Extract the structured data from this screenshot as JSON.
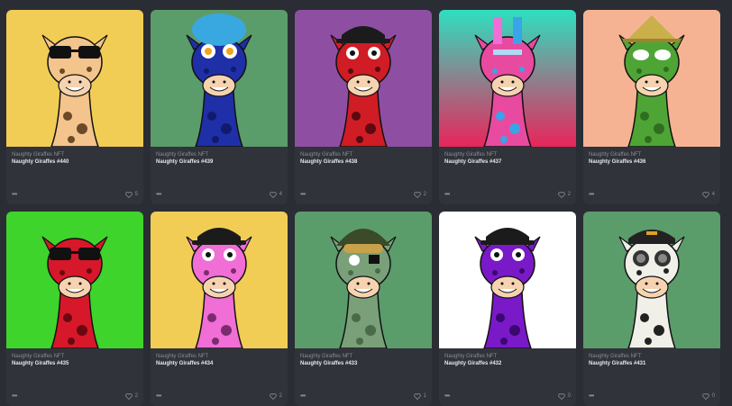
{
  "cards": [
    {
      "collection": "Naughty Giraffes NFT",
      "name": "Naughty Giraffes #440",
      "likes": "5",
      "bg": "#f2cd55",
      "body": "#f3c48b",
      "spots": "#6b4a28",
      "accessory": "sunglasses"
    },
    {
      "collection": "Naughty Giraffes NFT",
      "name": "Naughty Giraffes #439",
      "likes": "4",
      "bg": "#5b9c6b",
      "body": "#1f2fa8",
      "spots": "#111a6b",
      "accessory": "blue-hair"
    },
    {
      "collection": "Naughty Giraffes NFT",
      "name": "Naughty Giraffes #438",
      "likes": "2",
      "bg": "#8e4fa3",
      "body": "#d01c24",
      "spots": "#5a0a10",
      "accessory": "cap"
    },
    {
      "collection": "Naughty Giraffes NFT",
      "name": "Naughty Giraffes #437",
      "likes": "2",
      "bg": "#2ee0c0",
      "bg2": "#e8255b",
      "body": "#e84aa0",
      "spots": "#39a4e8",
      "accessory": "pixels"
    },
    {
      "collection": "Naughty Giraffes NFT",
      "name": "Naughty Giraffes #436",
      "likes": "4",
      "bg": "#f6b393",
      "body": "#4ea535",
      "spots": "#2f6e20",
      "accessory": "straw-hat"
    },
    {
      "collection": "Naughty Giraffes NFT",
      "name": "Naughty Giraffes #435",
      "likes": "2",
      "bg": "#3ed42b",
      "body": "#d6182a",
      "spots": "#6a0710",
      "accessory": "sunglasses"
    },
    {
      "collection": "Naughty Giraffes NFT",
      "name": "Naughty Giraffes #434",
      "likes": "2",
      "bg": "#f2cd55",
      "body": "#f06ed5",
      "spots": "#7a2c6e",
      "accessory": "cap"
    },
    {
      "collection": "Naughty Giraffes NFT",
      "name": "Naughty Giraffes #433",
      "likes": "1",
      "bg": "#5b9c6b",
      "body": "#7aa07a",
      "spots": "#4a6a4a",
      "accessory": "army-helmet"
    },
    {
      "collection": "Naughty Giraffes NFT",
      "name": "Naughty Giraffes #432",
      "likes": "0",
      "bg": "#ffffff",
      "body": "#7a19c8",
      "spots": "#3a0870",
      "accessory": "cap"
    },
    {
      "collection": "Naughty Giraffes NFT",
      "name": "Naughty Giraffes #431",
      "likes": "0",
      "bg": "#5b9c6b",
      "body": "#f0efe8",
      "spots": "#222222",
      "accessory": "pilot-cap"
    }
  ]
}
